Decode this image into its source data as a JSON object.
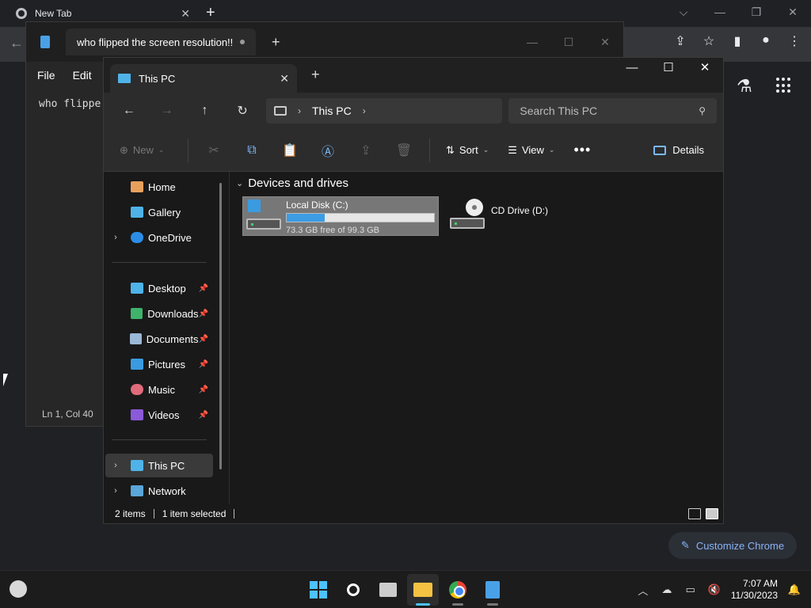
{
  "chrome": {
    "tab_title": "New Tab",
    "customize_label": "Customize Chrome"
  },
  "notepad": {
    "tab_title": "who flipped the screen resolution!!",
    "menu": [
      "File",
      "Edit"
    ],
    "text": "who flippe",
    "status": "Ln 1, Col 40"
  },
  "explorer": {
    "tab_title": "This PC",
    "path": "This PC",
    "search_placeholder": "Search This PC",
    "commands": {
      "new": "New",
      "sort": "Sort",
      "view": "View",
      "details": "Details"
    },
    "nav": {
      "home": "Home",
      "gallery": "Gallery",
      "onedrive": "OneDrive",
      "desktop": "Desktop",
      "downloads": "Downloads",
      "documents": "Documents",
      "pictures": "Pictures",
      "music": "Music",
      "videos": "Videos",
      "this_pc": "This PC",
      "network": "Network"
    },
    "group_header": "Devices and drives",
    "drives": {
      "c": {
        "name": "Local Disk (C:)",
        "free": "73.3 GB free of 99.3 GB",
        "used_fraction": 0.26
      },
      "d": {
        "name": "CD Drive (D:)"
      }
    },
    "status": {
      "items": "2 items",
      "selected": "1 item selected"
    }
  },
  "taskbar": {
    "time": "7:07 AM",
    "date": "11/30/2023"
  },
  "colors": {
    "accent": "#4cc2ff",
    "drive_bar": "#3c9ce4",
    "folder": "#f5c142"
  }
}
